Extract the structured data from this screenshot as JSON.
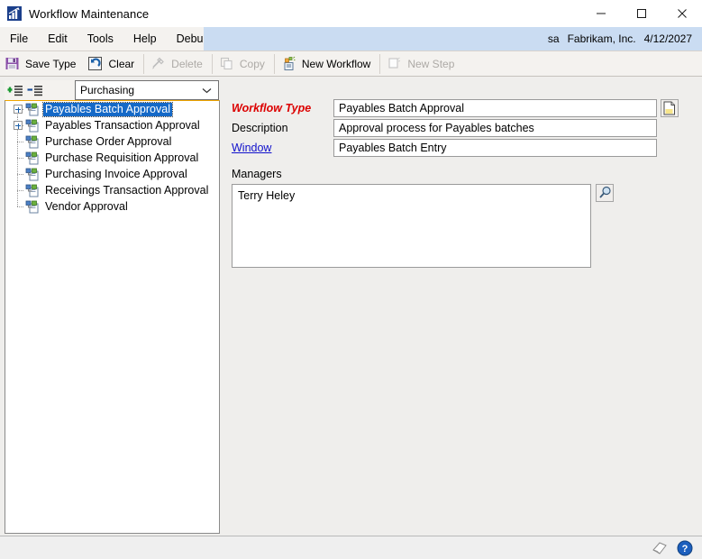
{
  "window": {
    "title": "Workflow Maintenance",
    "icon": "workflow-chart-icon",
    "controls": {
      "minimize": "minimize-icon",
      "maximize": "maximize-icon",
      "close": "close-icon"
    }
  },
  "menubar": {
    "items": [
      "File",
      "Edit",
      "Tools",
      "Help",
      "Debug"
    ],
    "status": {
      "user": "sa",
      "company": "Fabrikam, Inc.",
      "date": "4/12/2027"
    },
    "accent_color": "#cadcf2"
  },
  "toolbar": {
    "buttons": [
      {
        "label": "Save Type",
        "icon": "save-floppy-icon",
        "enabled": true
      },
      {
        "label": "Clear",
        "icon": "clear-undo-icon",
        "enabled": true
      },
      {
        "label": "Delete",
        "icon": "delete-icon",
        "enabled": false
      },
      {
        "label": "Copy",
        "icon": "copy-icon",
        "enabled": false
      },
      {
        "label": "New Workflow",
        "icon": "new-workflow-icon",
        "enabled": true
      },
      {
        "label": "New Step",
        "icon": "new-step-icon",
        "enabled": false
      }
    ]
  },
  "tree_panel": {
    "expand_all_icon": "expand-all-icon",
    "collapse_all_icon": "collapse-all-icon",
    "category_select": {
      "value": "Purchasing",
      "options": [
        "Purchasing"
      ]
    },
    "items": [
      {
        "label": "Payables Batch Approval",
        "expandable": true,
        "selected": true
      },
      {
        "label": "Payables Transaction Approval",
        "expandable": true,
        "selected": false
      },
      {
        "label": "Purchase Order Approval",
        "expandable": false,
        "selected": false
      },
      {
        "label": "Purchase Requisition Approval",
        "expandable": false,
        "selected": false
      },
      {
        "label": "Purchasing Invoice Approval",
        "expandable": false,
        "selected": false
      },
      {
        "label": "Receivings Transaction Approval",
        "expandable": false,
        "selected": false
      },
      {
        "label": "Vendor Approval",
        "expandable": false,
        "selected": false
      }
    ],
    "selection_color": "#1569c7"
  },
  "form": {
    "workflow_type": {
      "label": "Workflow Type",
      "value": "Payables Batch Approval",
      "required": true,
      "required_color": "#dc0000"
    },
    "description": {
      "label": "Description",
      "value": "Approval process for Payables batches"
    },
    "window_field": {
      "label": "Window",
      "value": "Payables Batch Entry",
      "is_link": true
    },
    "note_button_icon": "note-document-icon",
    "managers": {
      "label": "Managers",
      "entries": [
        "Terry Heley"
      ],
      "lookup_icon": "magnifier-lookup-icon"
    }
  },
  "statusbar": {
    "icons": [
      "note-icon",
      "help-question-icon"
    ]
  }
}
